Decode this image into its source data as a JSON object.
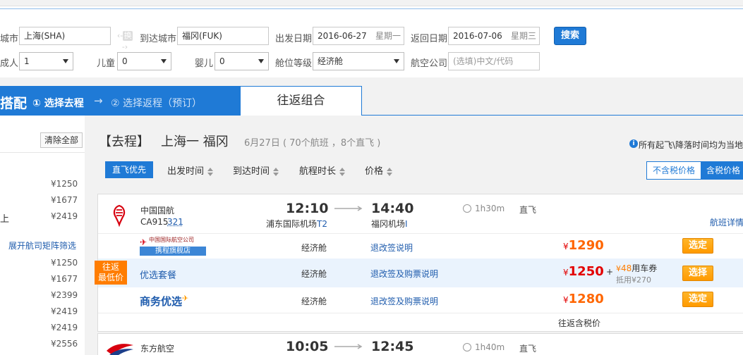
{
  "search": {
    "from_label": "城市",
    "from_value": "上海(SHA)",
    "swap_label": "换",
    "to_label": "到达城市",
    "to_value": "福冈(FUK)",
    "depart_label": "出发日期",
    "depart_value": "2016-06-27",
    "depart_week": "星期一",
    "return_label": "返回日期",
    "return_value": "2016-07-06",
    "return_week": "星期三",
    "search_button": "搜索",
    "adult_label": "成人",
    "adult_value": "1",
    "child_label": "儿童",
    "child_value": "0",
    "infant_label": "婴儿",
    "infant_value": "0",
    "cabin_label": "舱位等级",
    "cabin_value": "经济舱",
    "airline_label": "航空公司",
    "airline_placeholder": "(选填)中文/代码"
  },
  "steps": {
    "left_fragment": "搭配",
    "step1": "① 选择去程",
    "arrow": "→",
    "step2": "② 选择返程（预订）",
    "combo_tab": "往返组合"
  },
  "sidebar": {
    "clear_all": "清除全部",
    "prices_top": [
      "¥1250",
      "¥1677",
      "¥2419"
    ],
    "fragment_label": "上",
    "expand_link": "展开航司矩阵筛选",
    "prices_bottom": [
      "¥1250",
      "¥1677",
      "¥2399",
      "¥2419",
      "¥2419",
      "¥2556"
    ]
  },
  "results": {
    "title_tag": "【去程】",
    "title_route": "上海一 福冈",
    "summary": "6月27日 ( 70个航班 ，8个直飞 )",
    "note": "所有起飞\\降落时间均为当地",
    "sort": {
      "direct_first": "直飞优先",
      "depart_time": "出发时间",
      "arrive_time": "到达时间",
      "duration": "航程时长",
      "price": "价格"
    },
    "tax_toggle": {
      "excl": "不含税价格",
      "incl": "含税价格"
    }
  },
  "flights": [
    {
      "airline": "中国国航",
      "flight_no": "CA915",
      "aircraft": "321",
      "dep_time": "12:10",
      "arr_time": "14:40",
      "dep_airport": "浦东国际机场",
      "dep_terminal": "T2",
      "arr_airport": "福冈机场",
      "arr_terminal": "I",
      "duration": "1h30m",
      "direct": "直飞",
      "detail_link": "航班详情",
      "offers": [
        {
          "vendor": "中国国际航空公司",
          "vendor_sub": "携程旗舰店",
          "cabin": "经济舱",
          "policy": "退改签说明",
          "currency": "¥",
          "price": "1290",
          "button": "选定"
        },
        {
          "badge_line1": "往返",
          "badge_line2": "最低价",
          "vendor": "优选套餐",
          "cabin": "经济舱",
          "policy": "退改签及购票说明",
          "currency": "¥",
          "price": "1250",
          "plus": "+",
          "coupon_prefix": "¥",
          "coupon_amount": "48",
          "coupon_text": "用车券",
          "coupon_sub": "抵用¥270",
          "button": "选择"
        },
        {
          "vendor": "商务优选",
          "cabin": "经济舱",
          "policy": "退改签及购票说明",
          "currency": "¥",
          "price": "1280",
          "button": "选定"
        }
      ],
      "footer": "往返含税价"
    },
    {
      "airline": "东方航空",
      "dep_time": "10:05",
      "arr_time": "12:45",
      "duration": "1h40m",
      "direct": "直飞"
    }
  ],
  "colors": {
    "step_bar": "#1f7ad6",
    "search_button": "#1f7ad6",
    "price_red": "#e30000",
    "select_button": "#ff9a00",
    "link_blue": "#1f5cad"
  }
}
